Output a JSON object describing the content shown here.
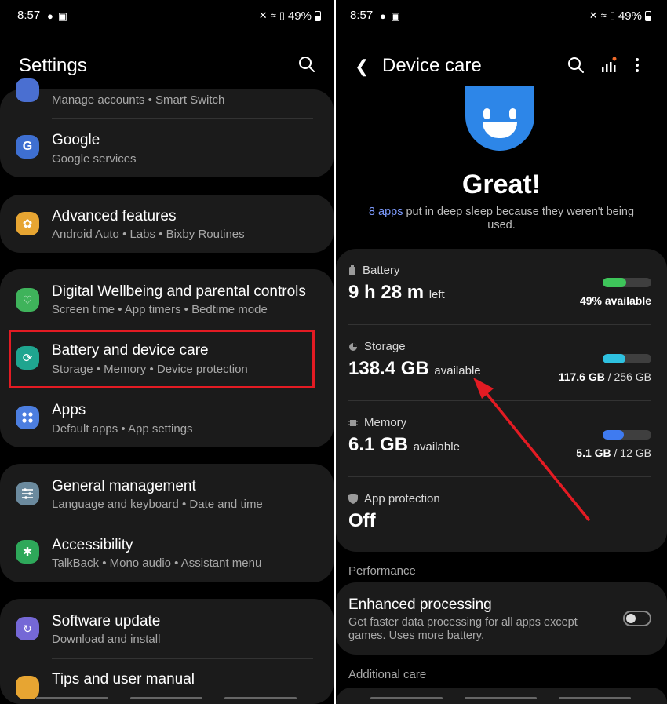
{
  "status_bar": {
    "time": "8:57",
    "battery": "49%"
  },
  "left": {
    "title": "Settings",
    "groups": [
      {
        "items": [
          {
            "title": "",
            "subtitle": "Manage accounts  •  Smart Switch",
            "icon": "accounts-icon"
          },
          {
            "title": "Google",
            "subtitle": "Google services",
            "icon": "google-icon"
          }
        ]
      },
      {
        "items": [
          {
            "title": "Advanced features",
            "subtitle": "Android Auto  •  Labs  •  Bixby Routines",
            "icon": "advanced-features-icon"
          }
        ]
      },
      {
        "items": [
          {
            "title": "Digital Wellbeing and parental controls",
            "subtitle": "Screen time  •  App timers  •  Bedtime mode",
            "icon": "wellbeing-icon"
          },
          {
            "title": "Battery and device care",
            "subtitle": "Storage  •  Memory  •  Device protection",
            "icon": "device-care-icon"
          },
          {
            "title": "Apps",
            "subtitle": "Default apps  •  App settings",
            "icon": "apps-icon"
          }
        ]
      },
      {
        "items": [
          {
            "title": "General management",
            "subtitle": "Language and keyboard  •  Date and time",
            "icon": "general-management-icon"
          },
          {
            "title": "Accessibility",
            "subtitle": "TalkBack  •  Mono audio  •  Assistant menu",
            "icon": "accessibility-icon"
          }
        ]
      },
      {
        "items": [
          {
            "title": "Software update",
            "subtitle": "Download and install",
            "icon": "software-update-icon"
          },
          {
            "title": "Tips and user manual",
            "subtitle": "",
            "icon": "tips-icon"
          }
        ]
      }
    ],
    "colors": {
      "google": "#3e6fd1",
      "advanced": "#e7a532",
      "wellbeing": "#3fb35b",
      "device_care": "#1fa58f",
      "apps": "#4c7ee0",
      "general": "#6b8a9e",
      "accessibility": "#2ea85a",
      "software": "#7568d6",
      "tips": "#e7a532",
      "highlight": "#e31b23"
    }
  },
  "right": {
    "title": "Device care",
    "headline": "Great!",
    "deep_sleep_link": "8 apps",
    "deep_sleep_text": " put in deep sleep because they weren't being used.",
    "battery": {
      "label": "Battery",
      "value": "9 h 28 m",
      "unit": "left",
      "stat": "49% available",
      "level": 0.49,
      "color": "#3ec55a"
    },
    "storage": {
      "label": "Storage",
      "value": "138.4 GB",
      "unit": "available",
      "stat_used": "117.6 GB",
      "stat_total": " / 256 GB",
      "level": 0.46,
      "color": "#2ec1e0"
    },
    "memory": {
      "label": "Memory",
      "value": "6.1 GB",
      "unit": "available",
      "stat_used": "5.1 GB",
      "stat_total": " / 12 GB",
      "level": 0.43,
      "color": "#3f7bf0"
    },
    "protection": {
      "label": "App protection",
      "value": "Off"
    },
    "performance_header": "Performance",
    "enhanced": {
      "title": "Enhanced processing",
      "subtitle": "Get faster data processing for all apps except games. Uses more battery.",
      "enabled": false
    },
    "additional_header": "Additional care"
  }
}
